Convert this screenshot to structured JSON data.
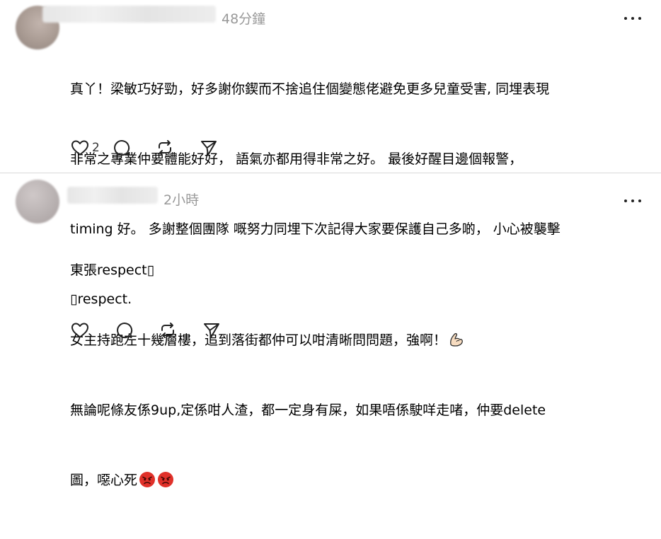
{
  "posts": [
    {
      "time": "48分鐘",
      "lines": [
        "真丫！梁敏巧好勁，好多謝你鍥而不捨追住個變態佬避免更多兒童受害, 同埋表現",
        "非常之專業仲要體能好好， 語氣亦都用得非常之好。 最後好醒目邊個報警，",
        "timing 好。 多謝整個團隊 嘅努力同埋下次記得大家要保護自己多啲， 小心被襲擊",
        "▯respect."
      ],
      "like_count": "2",
      "icons": [
        "heart-icon",
        "comment-icon",
        "repost-icon",
        "share-icon"
      ]
    },
    {
      "time": "2小時",
      "lines": [
        "東張respect▯",
        "女主持跑左十幾層樓，追到落街都仲可以咁清晰問問題，強啊！",
        "無論呢條友係9up,定係咁人渣，都一定身有屎，如果唔係駛咩走啫，仲要delete",
        "圖，噁心死"
      ],
      "like_count": "",
      "icons": [
        "heart-icon",
        "comment-icon",
        "repost-icon",
        "share-icon"
      ],
      "emojis": [
        "flexed-biceps-emoji",
        "angry-face-emoji",
        "angry-face-emoji"
      ]
    }
  ],
  "colors": {
    "text": "#000000",
    "muted": "#999999",
    "divider": "#d9d9d9",
    "angry": "#e0312a"
  }
}
